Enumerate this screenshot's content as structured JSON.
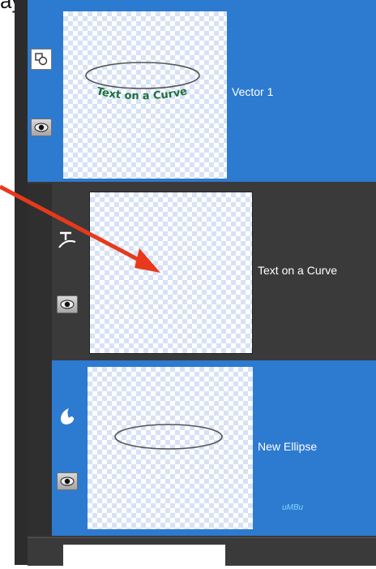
{
  "page_fragment": "ayers",
  "layers": [
    {
      "name": "Vector 1",
      "type_icon": "vector-layer-icon",
      "visibility_icon": "eye-icon",
      "selected": true,
      "thumbnail_text": "Text on a Curve"
    },
    {
      "name": "Text on a Curve",
      "type_icon": "text-path-icon",
      "visibility_icon": "eye-icon",
      "selected": false
    },
    {
      "name": "New Ellipse",
      "type_icon": "shape-icon",
      "visibility_icon": "eye-icon",
      "selected": true,
      "thumbnail_watermark": "uMBu"
    }
  ],
  "colors": {
    "selected_layer": "#2d7ad1",
    "dark_panel": "#3a3a3a",
    "annotation_arrow": "#e8391c",
    "curve_text": "#1d6e3a"
  }
}
